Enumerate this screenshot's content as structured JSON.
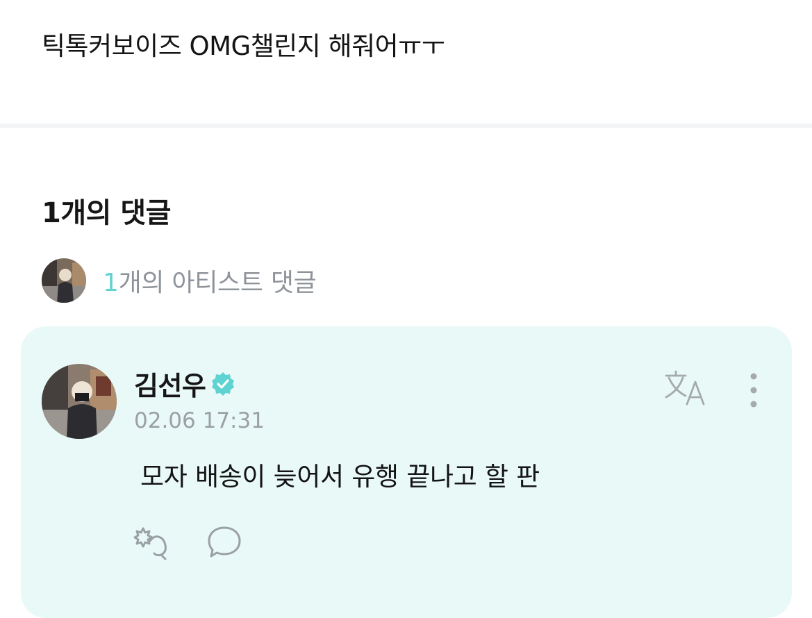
{
  "post": {
    "text": "틱톡커보이즈 OMG챌린지 해줘어ㅠㅜ"
  },
  "comments_header": {
    "title": "1개의 댓글"
  },
  "artist_summary": {
    "count": "1",
    "label": "개의 아티스트 댓글"
  },
  "comment": {
    "author": "김선우",
    "timestamp": "02.06 17:31",
    "body": "모자 배송이 늦어서 유행 끝나고 할 판",
    "verified_icon": "verified-badge-icon",
    "translate_icon": "translate-icon",
    "more_icon": "more-options-icon",
    "applause_icon": "applause-icon",
    "reply_icon": "reply-icon"
  },
  "colors": {
    "accent": "#5fd3d1",
    "card_background": "#e9f9f7",
    "muted_text": "#9aa0a6"
  }
}
